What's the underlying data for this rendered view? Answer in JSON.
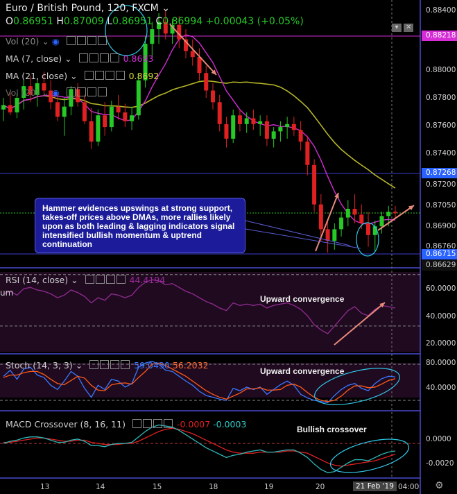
{
  "header": {
    "symbol": "Euro / British Pound, 120, FXCM",
    "o_label": "O",
    "o": "0.86951",
    "h_label": "H",
    "h": "0.87009",
    "l_label": "L",
    "l": "0.86951",
    "c_label": "C",
    "c": "0.86994",
    "change": "+0.00043 (+0.05%)"
  },
  "legend": {
    "vol": "Vol (20)",
    "ma7": "MA (7, close)",
    "ma7_value": "0.8693",
    "ma21": "MA (21, close)",
    "ma21_value": "0.8692",
    "vol2": "Vol (20)"
  },
  "price_axis": {
    "ticks": [
      "0.88400",
      "0.88000",
      "0.87800",
      "0.87600",
      "0.87400",
      "0.87200",
      "0.87050",
      "0.86900",
      "0.86760"
    ],
    "tags": {
      "top": "0.88218",
      "mid": "0.87268",
      "low": "0.86715",
      "bottom": "0.86629"
    }
  },
  "annotation_box": "Hammer evidences upswings at strong support, takes-off prices above DMAs, more rallies likely upon as both leading & lagging indicators signal intensified bullish momentum & uptrend continuation",
  "rsi": {
    "label": "RSI (14, close)",
    "value": "44.4194",
    "prefix": "um",
    "annotation": "Upward convergence",
    "ticks": [
      "60.0000",
      "40.0000",
      "20.0000"
    ]
  },
  "stoch": {
    "label": "Stoch (14, 3, 3)",
    "k": "59.0430",
    "d": "56.2032",
    "annotation": "Upward convergence",
    "ticks": [
      "80.0000",
      "40.0000"
    ]
  },
  "macd": {
    "label": "MACD Crossover (8, 16, 11)",
    "v1": "-0.0007",
    "v2": "-0.0003",
    "annotation": "Bullish crossover",
    "ticks": [
      "0.0000",
      "-0.0020"
    ]
  },
  "time_axis": {
    "ticks": [
      "13",
      "14",
      "15",
      "18",
      "19",
      "20"
    ],
    "current": "21 Feb '19",
    "time": "04:00"
  },
  "colors": {
    "up": "#26c926",
    "down": "#e02121",
    "ma7": "#d62cd6",
    "ma21": "#b5b52a",
    "accent": "#2962ff",
    "arrow": "#e88a7a",
    "ellipse": "#30c8e8"
  },
  "chart_data": {
    "type": "candlestick",
    "title": "Euro / British Pound, 120, FXCM",
    "ylim": [
      0.8663,
      0.8845
    ],
    "candles_ohlc": [
      [
        0.877,
        0.8778,
        0.8762,
        0.8773
      ],
      [
        0.8773,
        0.8782,
        0.8766,
        0.8768
      ],
      [
        0.8768,
        0.8781,
        0.8764,
        0.8778
      ],
      [
        0.8778,
        0.879,
        0.877,
        0.8786
      ],
      [
        0.8786,
        0.8793,
        0.8775,
        0.878
      ],
      [
        0.878,
        0.8791,
        0.8772,
        0.8788
      ],
      [
        0.8788,
        0.8796,
        0.878,
        0.8783
      ],
      [
        0.8783,
        0.879,
        0.877,
        0.8775
      ],
      [
        0.8775,
        0.878,
        0.8762,
        0.8765
      ],
      [
        0.8765,
        0.8778,
        0.8752,
        0.8772
      ],
      [
        0.8772,
        0.8786,
        0.8766,
        0.8784
      ],
      [
        0.8784,
        0.8788,
        0.8772,
        0.8775
      ],
      [
        0.8775,
        0.878,
        0.876,
        0.8762
      ],
      [
        0.8762,
        0.8771,
        0.8743,
        0.8748
      ],
      [
        0.8748,
        0.877,
        0.8745,
        0.8766
      ],
      [
        0.8766,
        0.8775,
        0.8752,
        0.8758
      ],
      [
        0.8758,
        0.8776,
        0.8755,
        0.8772
      ],
      [
        0.8772,
        0.878,
        0.8763,
        0.8768
      ],
      [
        0.8768,
        0.8774,
        0.8758,
        0.8762
      ],
      [
        0.8762,
        0.8772,
        0.8756,
        0.8766
      ],
      [
        0.8766,
        0.8795,
        0.8763,
        0.879
      ],
      [
        0.879,
        0.882,
        0.8785,
        0.8815
      ],
      [
        0.8815,
        0.883,
        0.8805,
        0.8825
      ],
      [
        0.8825,
        0.8836,
        0.8815,
        0.883
      ],
      [
        0.883,
        0.8838,
        0.8818,
        0.8822
      ],
      [
        0.8822,
        0.8832,
        0.8815,
        0.8828
      ],
      [
        0.8828,
        0.8834,
        0.8812,
        0.8818
      ],
      [
        0.8818,
        0.8825,
        0.8805,
        0.881
      ],
      [
        0.881,
        0.8818,
        0.88,
        0.8806
      ],
      [
        0.8806,
        0.8812,
        0.879,
        0.8795
      ],
      [
        0.8795,
        0.88,
        0.8778,
        0.8783
      ],
      [
        0.8783,
        0.8788,
        0.877,
        0.8775
      ],
      [
        0.8775,
        0.878,
        0.8755,
        0.876
      ],
      [
        0.876,
        0.8765,
        0.8744,
        0.875
      ],
      [
        0.875,
        0.877,
        0.8747,
        0.8766
      ],
      [
        0.8766,
        0.877,
        0.8755,
        0.876
      ],
      [
        0.876,
        0.8768,
        0.8754,
        0.8764
      ],
      [
        0.8764,
        0.877,
        0.8756,
        0.876
      ],
      [
        0.876,
        0.8766,
        0.8752,
        0.8762
      ],
      [
        0.8762,
        0.8766,
        0.8745,
        0.875
      ],
      [
        0.875,
        0.8758,
        0.8744,
        0.8755
      ],
      [
        0.8755,
        0.8762,
        0.8748,
        0.8758
      ],
      [
        0.8758,
        0.8765,
        0.875,
        0.876
      ],
      [
        0.876,
        0.8765,
        0.8752,
        0.8756
      ],
      [
        0.8756,
        0.8762,
        0.8742,
        0.8748
      ],
      [
        0.8748,
        0.8752,
        0.8725,
        0.8732
      ],
      [
        0.8732,
        0.8736,
        0.87,
        0.8705
      ],
      [
        0.8705,
        0.8712,
        0.868,
        0.8688
      ],
      [
        0.8688,
        0.8694,
        0.8672,
        0.868
      ],
      [
        0.868,
        0.8692,
        0.8674,
        0.8688
      ],
      [
        0.8688,
        0.87,
        0.8683,
        0.8696
      ],
      [
        0.8696,
        0.8708,
        0.869,
        0.8702
      ],
      [
        0.8702,
        0.8712,
        0.8692,
        0.8698
      ],
      [
        0.8698,
        0.8705,
        0.8688,
        0.8692
      ],
      [
        0.8692,
        0.87,
        0.8676,
        0.8684
      ],
      [
        0.8684,
        0.8694,
        0.8673,
        0.869
      ],
      [
        0.869,
        0.87,
        0.8685,
        0.8697
      ],
      [
        0.8697,
        0.8704,
        0.869,
        0.87
      ],
      [
        0.87,
        0.8704,
        0.8695,
        0.8699
      ]
    ],
    "ma7_label": "MA (7, close)",
    "ma21_label": "MA (21, close)",
    "rsi_values": [
      55,
      57,
      54,
      59,
      60,
      58,
      57,
      55,
      52,
      54,
      58,
      56,
      53,
      48,
      52,
      50,
      55,
      54,
      52,
      54,
      60,
      64,
      66,
      65,
      62,
      63,
      60,
      57,
      55,
      52,
      49,
      47,
      44,
      42,
      48,
      46,
      47,
      46,
      47,
      44,
      46,
      47,
      48,
      46,
      43,
      38,
      31,
      27,
      24,
      30,
      36,
      42,
      45,
      40,
      38,
      43,
      46,
      45,
      44
    ],
    "stoch_k": [
      60,
      70,
      55,
      72,
      75,
      62,
      58,
      45,
      38,
      52,
      68,
      60,
      40,
      25,
      45,
      38,
      55,
      52,
      42,
      48,
      75,
      82,
      85,
      80,
      70,
      68,
      60,
      52,
      45,
      35,
      28,
      25,
      22,
      20,
      40,
      36,
      42,
      38,
      42,
      30,
      38,
      46,
      52,
      45,
      30,
      24,
      20,
      18,
      16,
      28,
      38,
      45,
      48,
      40,
      36,
      48,
      56,
      60,
      59
    ],
    "stoch_d": [
      58,
      62,
      62,
      66,
      68,
      68,
      63,
      55,
      48,
      46,
      53,
      60,
      57,
      45,
      37,
      36,
      46,
      48,
      49,
      47,
      58,
      68,
      80,
      82,
      78,
      72,
      66,
      60,
      52,
      44,
      36,
      30,
      25,
      22,
      27,
      32,
      39,
      39,
      41,
      37,
      37,
      38,
      45,
      47,
      42,
      33,
      25,
      20,
      18,
      20,
      27,
      37,
      44,
      44,
      41,
      42,
      47,
      53,
      56
    ],
    "macd_values": [
      0.0,
      0.0002,
      0.0003,
      0.0005,
      0.0006,
      0.0006,
      0.0005,
      0.0003,
      0.0001,
      0.0001,
      0.0003,
      0.0004,
      0.0002,
      -0.0002,
      -0.0002,
      -0.0003,
      -0.0001,
      0.0,
      0.0,
      0.0001,
      0.0006,
      0.0011,
      0.0015,
      0.0017,
      0.0016,
      0.0015,
      0.0012,
      0.0008,
      0.0004,
      0.0,
      -0.0004,
      -0.0007,
      -0.001,
      -0.0013,
      -0.0011,
      -0.001,
      -0.0008,
      -0.0007,
      -0.0006,
      -0.0008,
      -0.0008,
      -0.0007,
      -0.0006,
      -0.0006,
      -0.0009,
      -0.0013,
      -0.0019,
      -0.0024,
      -0.0027,
      -0.0026,
      -0.0022,
      -0.0018,
      -0.0015,
      -0.0015,
      -0.0016,
      -0.0013,
      -0.001,
      -0.0008,
      -0.0007
    ],
    "macd_signal": [
      0.0001,
      0.0001,
      0.0002,
      0.0003,
      0.0004,
      0.0005,
      0.0005,
      0.0004,
      0.0003,
      0.0002,
      0.0002,
      0.0003,
      0.0003,
      0.0001,
      0.0,
      -0.0001,
      -0.0001,
      -0.0001,
      0.0,
      0.0,
      0.0002,
      0.0005,
      0.0008,
      0.0011,
      0.0013,
      0.0014,
      0.0013,
      0.0011,
      0.0009,
      0.0006,
      0.0003,
      0.0,
      -0.0003,
      -0.0006,
      -0.0008,
      -0.0009,
      -0.0009,
      -0.0009,
      -0.0008,
      -0.0008,
      -0.0008,
      -0.0008,
      -0.0007,
      -0.0007,
      -0.0008,
      -0.0009,
      -0.0012,
      -0.0015,
      -0.0018,
      -0.002,
      -0.0021,
      -0.002,
      -0.0019,
      -0.0018,
      -0.0017,
      -0.0016,
      -0.0014,
      -0.0012,
      -0.001
    ]
  }
}
